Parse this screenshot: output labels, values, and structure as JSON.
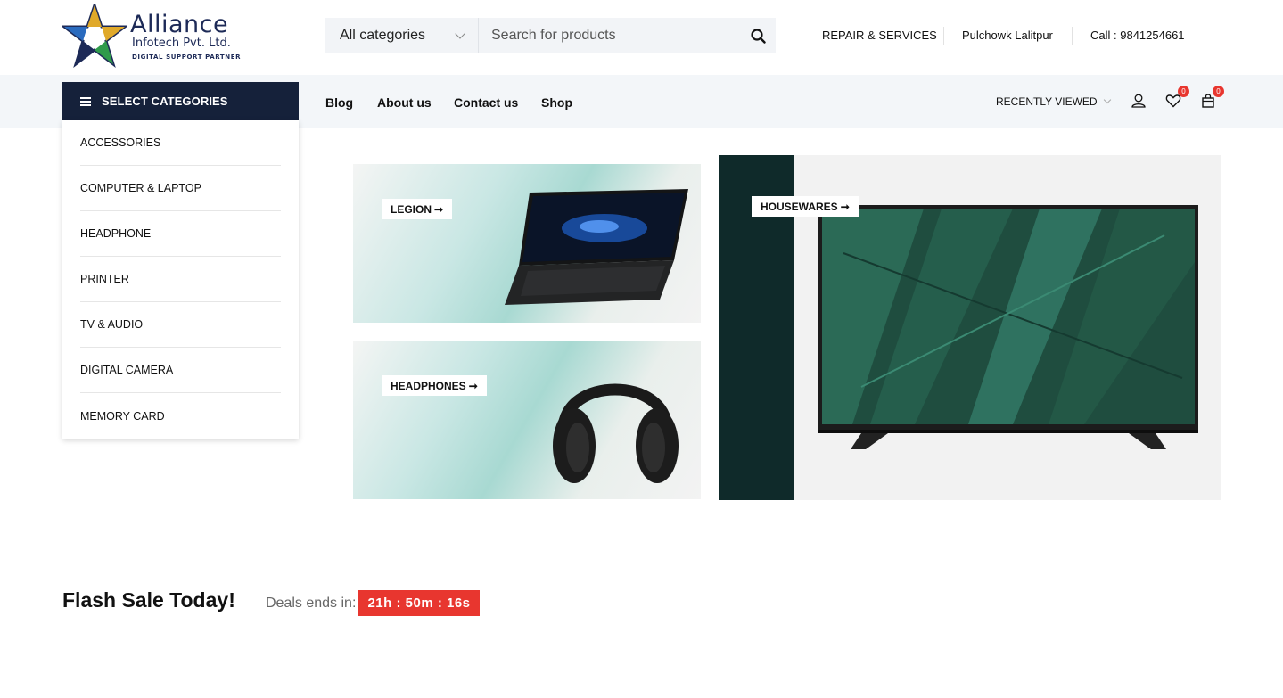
{
  "brand": {
    "name": "Alliance",
    "sub": "Infotech Pvt. Ltd.",
    "tagline": "DIGITAL SUPPORT PARTNER"
  },
  "search": {
    "category": "All categories",
    "placeholder": "Search for products"
  },
  "top_links": {
    "repair": "REPAIR & SERVICES",
    "location": "Pulchowk Lalitpur",
    "call": "Call : 9841254661"
  },
  "nav": {
    "select_categories": "SELECT CATEGORIES",
    "links": [
      "Blog",
      "About us",
      "Contact us",
      "Shop"
    ],
    "recently_viewed": "RECENTLY VIEWED",
    "wishlist_count": "0",
    "cart_count": "0"
  },
  "categories": [
    "ACCESSORIES",
    "COMPUTER & LAPTOP",
    "HEADPHONE",
    "PRINTER",
    "TV & AUDIO",
    "DIGITAL CAMERA",
    "MEMORY CARD"
  ],
  "banners": {
    "legion": "LEGION",
    "headphones": "HEADPHONES",
    "housewares": "HOUSEWARES"
  },
  "flash": {
    "title": "Flash Sale Today!",
    "deals_label": "Deals ends in:",
    "timer": "21h : 50m : 16s"
  },
  "colors": {
    "nav_dark": "#15213a",
    "accent_red": "#e8362f",
    "nav_bg": "#f3f6f9"
  }
}
